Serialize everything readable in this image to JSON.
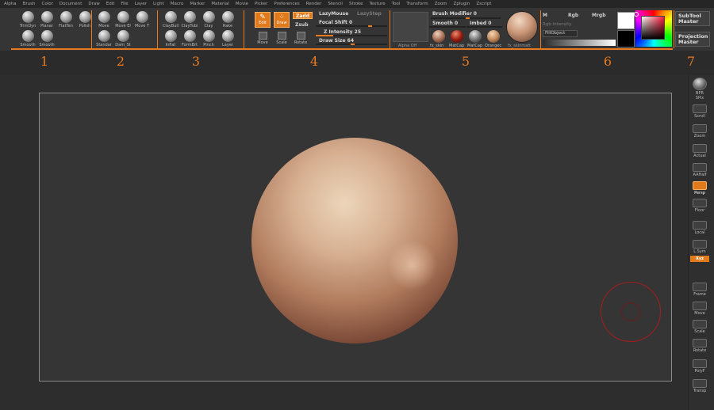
{
  "menu": [
    "Alpha",
    "Brush",
    "Color",
    "Document",
    "Draw",
    "Edit",
    "File",
    "Layer",
    "Light",
    "Macro",
    "Marker",
    "Material",
    "Movie",
    "Picker",
    "Preferences",
    "Render",
    "Stencil",
    "Stroke",
    "Texture",
    "Tool",
    "Transform",
    "Zoom",
    "Zplugin",
    "Zscript"
  ],
  "group1": {
    "brushes": [
      "TrimDyn",
      "Planar",
      "FlatTen",
      "Polish",
      "Smooth",
      "Smooth"
    ],
    "number": "1"
  },
  "group2": {
    "brushes": [
      "Move",
      "Move El",
      "Move T",
      "Standar",
      "Dam_St"
    ],
    "number": "2"
  },
  "group3": {
    "brushes": [
      "ClayBuil",
      "ClayTubi",
      "Clay",
      "Rake",
      "Inflat",
      "FormBrt",
      "Pinch",
      "Layer"
    ],
    "number": "3"
  },
  "group4": {
    "number": "4",
    "edit": "Edit",
    "draw": "Draw",
    "zadd": "Zadd",
    "zsub": "Zsub",
    "move": "Move",
    "scale": "Scale",
    "rotate": "Rotate",
    "lazymouse": "LazyMouse",
    "lazystep": "LazyStep",
    "focal_shift": "Focal Shift 0",
    "z_intensity": "Z Intensity 25",
    "draw_size": "Draw Size 64"
  },
  "group5": {
    "number": "5",
    "alpha_label": "Alpha Off",
    "brush_modifier": "Brush Modifier 0",
    "smooth": "Smooth 0",
    "imbed": "Imbed 0",
    "materials": [
      "fx_skin",
      "MatCap",
      "MatCap",
      "Orangec"
    ],
    "main_material": "fx_skinmatt"
  },
  "group6": {
    "number": "6",
    "m": "M",
    "rgb": "Rgb",
    "mrgb": "Mrgb",
    "rgb_intensity": "Rgb Intensity",
    "fill_object": "FillObject",
    "main_color": "#ffffff",
    "secondary_color": "#000000"
  },
  "group7": {
    "number": "7",
    "subtool_master": "SubTool Master",
    "projection_master": "Projection Master"
  },
  "tray": [
    "BPR",
    "SPix",
    "Scroll",
    "Zoom",
    "Actual",
    "AAHalf",
    "Persp",
    "Floor",
    "Local",
    "L.Sym",
    "Xyz",
    "",
    "Frame",
    "Move",
    "Scale",
    "Rotate",
    "PolyF",
    "Transp"
  ],
  "tray_active": [
    "Persp",
    "Xyz"
  ],
  "accent_color": "#e8791f"
}
